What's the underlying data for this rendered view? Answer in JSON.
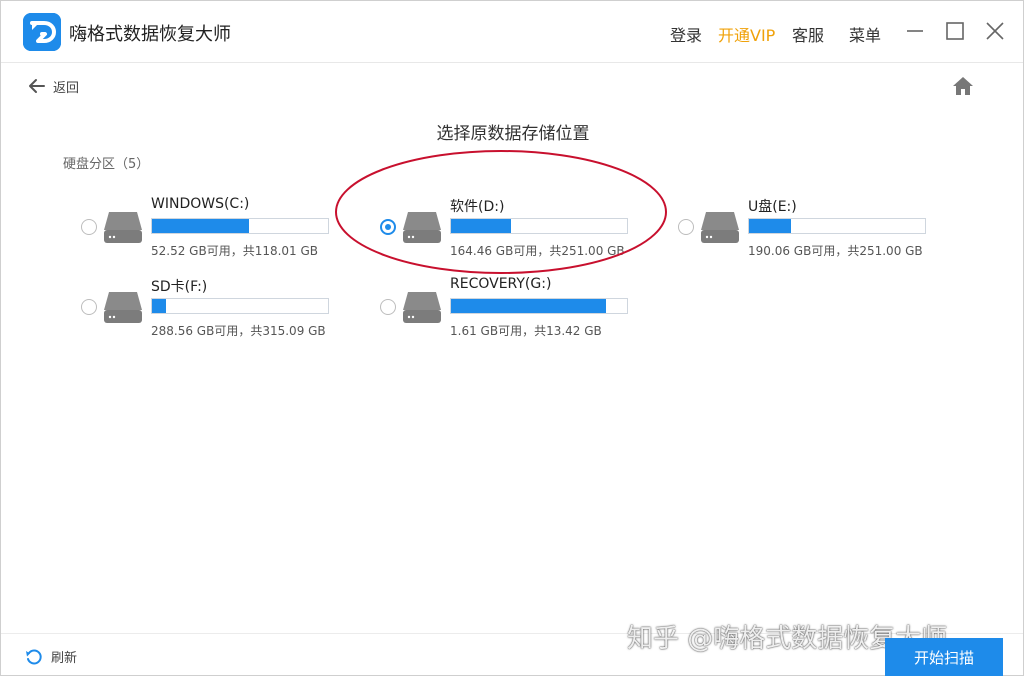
{
  "app": {
    "title": "嗨格式数据恢复大师",
    "menu": {
      "login": "登录",
      "vip": "开通VIP",
      "service": "客服",
      "menu": "菜单"
    }
  },
  "colors": {
    "accent": "#1e8bea",
    "vip": "#f0a20a",
    "annotation": "#c8102e"
  },
  "nav": {
    "back_label": "返回"
  },
  "page": {
    "title": "选择原数据存储位置"
  },
  "section": {
    "label": "硬盘分区（5）"
  },
  "drives": [
    {
      "name": "WINDOWS(C:)",
      "info": "52.52 GB可用，共118.01 GB",
      "used_fraction": 0.55,
      "selected": false
    },
    {
      "name": "软件(D:)",
      "info": "164.46 GB可用，共251.00 GB",
      "used_fraction": 0.34,
      "selected": true
    },
    {
      "name": "U盘(E:)",
      "info": "190.06 GB可用，共251.00 GB",
      "used_fraction": 0.24,
      "selected": false
    },
    {
      "name": "SD卡(F:)",
      "info": "288.56 GB可用，共315.09 GB",
      "used_fraction": 0.08,
      "selected": false
    },
    {
      "name": "RECOVERY(G:)",
      "info": "1.61 GB可用，共13.42 GB",
      "used_fraction": 0.88,
      "selected": false
    }
  ],
  "footer": {
    "refresh_label": "刷新",
    "scan_label": "开始扫描"
  },
  "watermark": "知乎 @嗨格式数据恢复大师"
}
